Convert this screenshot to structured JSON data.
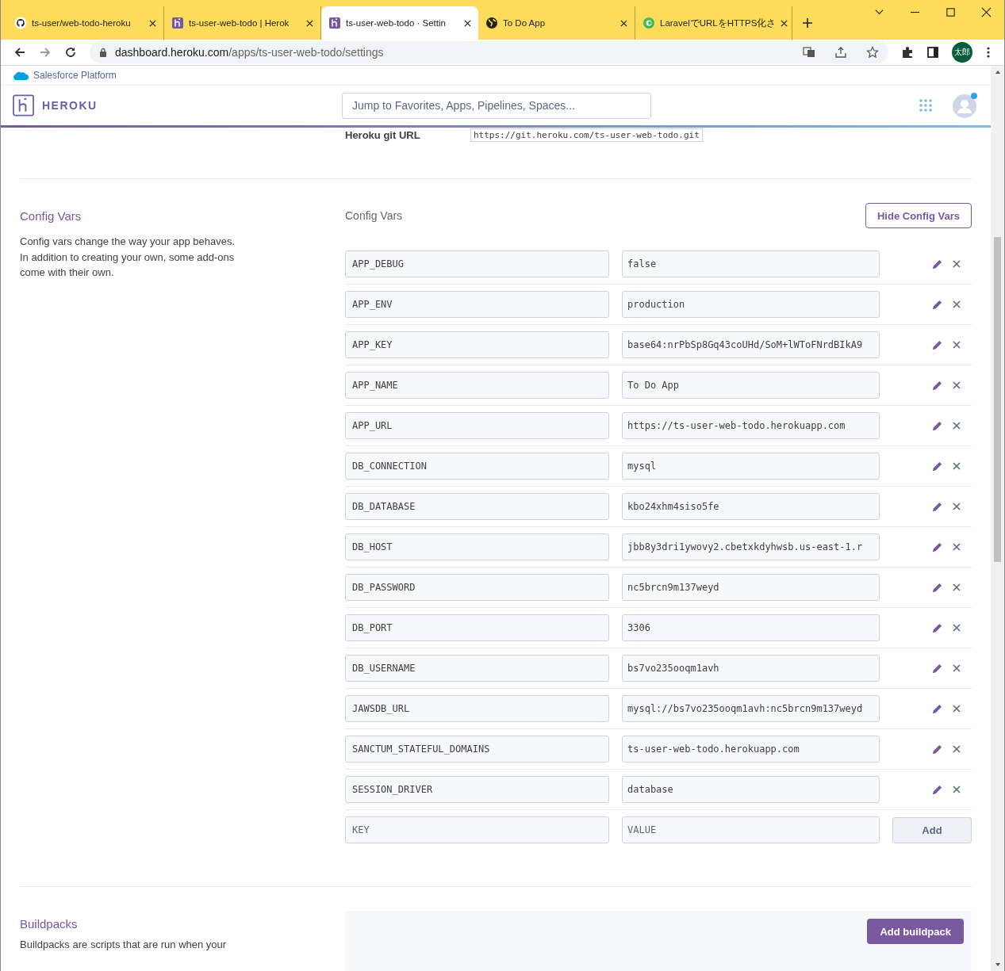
{
  "tabs": [
    {
      "title": "ts-user/web-todo-heroku",
      "kind": "github",
      "selected": false
    },
    {
      "title": "ts-user-web-todo | Herok",
      "kind": "heroku",
      "selected": false
    },
    {
      "title": "ts-user-web-todo · Settin",
      "kind": "heroku",
      "selected": true
    },
    {
      "title": "To Do App",
      "kind": "globe",
      "selected": false
    },
    {
      "title": "LaravelでURLをHTTPS化さ",
      "kind": "laravel",
      "selected": false
    }
  ],
  "address": {
    "host": "dashboard.heroku.com",
    "path": "/apps/ts-user-web-todo/settings"
  },
  "profile": {
    "initials": "太郎"
  },
  "salesforce_bar": {
    "label": "Salesforce Platform"
  },
  "header": {
    "logo": "HEROKU",
    "search": {
      "placeholder": "Jump to Favorites, Apps, Pipelines, Spaces..."
    }
  },
  "git_url": {
    "label": "Heroku git URL",
    "value": "https://git.heroku.com/ts-user-web-todo.git"
  },
  "config": {
    "title": "Config Vars",
    "description": "Config vars change the way your app behaves. In addition to creating your own, some add-ons come with their own.",
    "heading": "Config Vars",
    "hide_button": "Hide Config Vars",
    "vars": [
      {
        "key": "APP_DEBUG",
        "value": "false"
      },
      {
        "key": "APP_ENV",
        "value": "production"
      },
      {
        "key": "APP_KEY",
        "value": "base64:nrPbSp8Gq43coUHd/SoM+lWToFNrdBIkA9"
      },
      {
        "key": "APP_NAME",
        "value": "To Do App"
      },
      {
        "key": "APP_URL",
        "value": "https://ts-user-web-todo.herokuapp.com"
      },
      {
        "key": "DB_CONNECTION",
        "value": "mysql"
      },
      {
        "key": "DB_DATABASE",
        "value": "kbo24xhm4siso5fe"
      },
      {
        "key": "DB_HOST",
        "value": "jbb8y3dri1ywovy2.cbetxkdyhwsb.us-east-1.r"
      },
      {
        "key": "DB_PASSWORD",
        "value": "nc5brcn9m137weyd"
      },
      {
        "key": "DB_PORT",
        "value": "3306"
      },
      {
        "key": "DB_USERNAME",
        "value": "bs7vo235ooqm1avh"
      },
      {
        "key": "JAWSDB_URL",
        "value": "mysql://bs7vo235ooqm1avh:nc5brcn9m137weyd"
      },
      {
        "key": "SANCTUM_STATEFUL_DOMAINS",
        "value": "ts-user-web-todo.herokuapp.com"
      },
      {
        "key": "SESSION_DRIVER",
        "value": "database"
      }
    ],
    "new_row": {
      "key_placeholder": "KEY",
      "value_placeholder": "VALUE",
      "add_button": "Add"
    }
  },
  "buildpacks": {
    "title": "Buildpacks",
    "description": "Buildpacks are scripts that are run when your",
    "add_button": "Add buildpack"
  }
}
